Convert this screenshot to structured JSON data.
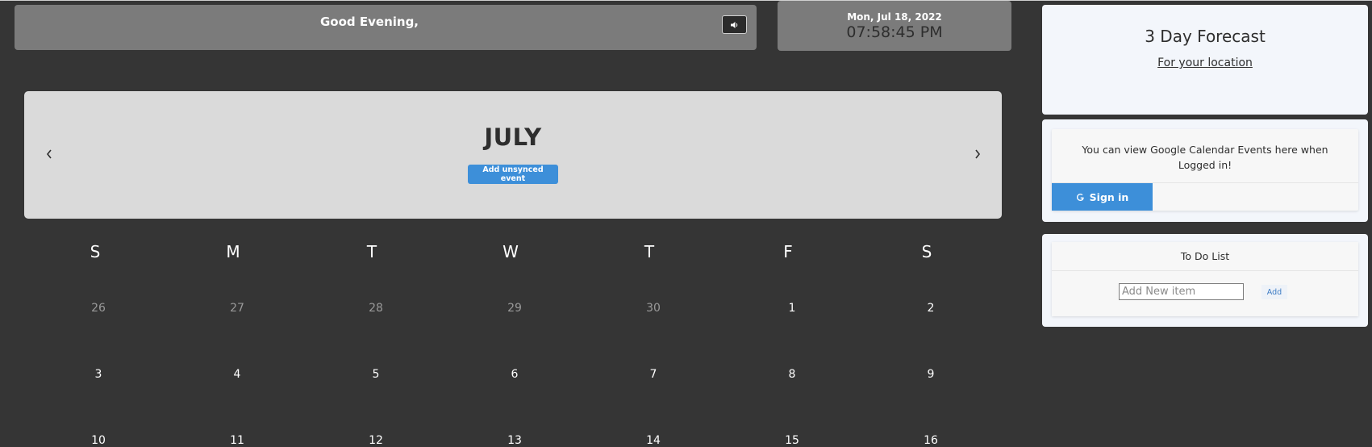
{
  "header": {
    "greeting": "Good Evening,",
    "sound_icon": "speaker-icon"
  },
  "clock": {
    "date": "Mon, Jul 18, 2022",
    "time": "07:58:45 PM"
  },
  "calendar": {
    "month": "JULY",
    "add_event_label": "Add unsynced event",
    "prev_icon": "chevron-left-icon",
    "next_icon": "chevron-right-icon",
    "weekdays": [
      "S",
      "M",
      "T",
      "W",
      "T",
      "F",
      "S"
    ],
    "weeks": [
      [
        {
          "day": "26",
          "current": false
        },
        {
          "day": "27",
          "current": false
        },
        {
          "day": "28",
          "current": false
        },
        {
          "day": "29",
          "current": false
        },
        {
          "day": "30",
          "current": false
        },
        {
          "day": "1",
          "current": true
        },
        {
          "day": "2",
          "current": true
        }
      ],
      [
        {
          "day": "3",
          "current": true
        },
        {
          "day": "4",
          "current": true
        },
        {
          "day": "5",
          "current": true
        },
        {
          "day": "6",
          "current": true
        },
        {
          "day": "7",
          "current": true
        },
        {
          "day": "8",
          "current": true
        },
        {
          "day": "9",
          "current": true
        }
      ],
      [
        {
          "day": "10",
          "current": true
        },
        {
          "day": "11",
          "current": true
        },
        {
          "day": "12",
          "current": true
        },
        {
          "day": "13",
          "current": true
        },
        {
          "day": "14",
          "current": true
        },
        {
          "day": "15",
          "current": true
        },
        {
          "day": "16",
          "current": true
        }
      ]
    ]
  },
  "forecast": {
    "title": "3 Day Forecast",
    "subtitle": "For your location"
  },
  "google_calendar": {
    "message": "You can view Google Calendar Events here when Logged in!",
    "signin_label": "Sign in",
    "signin_icon": "google-icon"
  },
  "todo": {
    "title": "To Do List",
    "input_placeholder": "Add New item",
    "input_value": "",
    "add_label": "Add"
  },
  "colors": {
    "background": "#353535",
    "accent": "#3d8fd9",
    "header_bar": "#7b7b7b",
    "month_card": "#dadada",
    "panel": "#f3f6fb"
  }
}
